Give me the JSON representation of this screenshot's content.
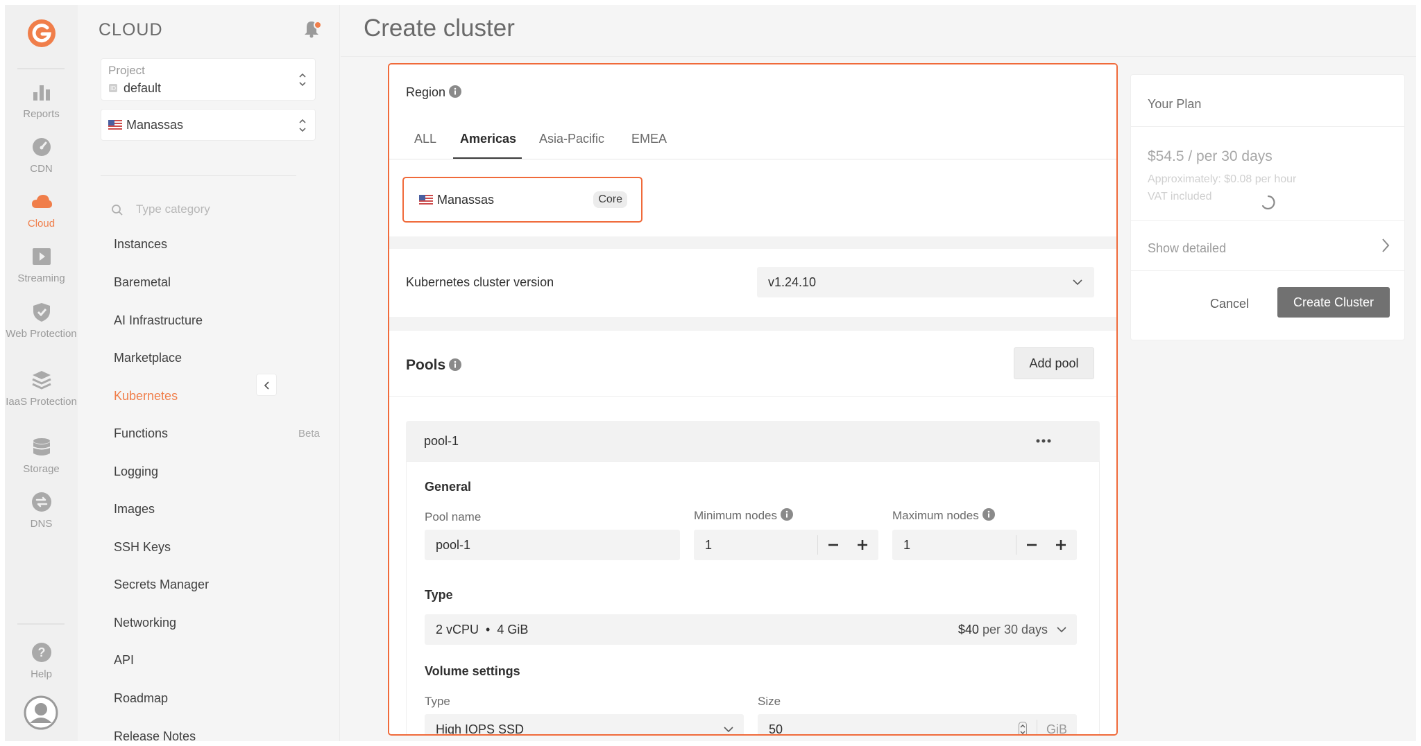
{
  "colors": {
    "accent": "#f07e4a",
    "focus_border": "#f06a3a",
    "primary_button": "#717171"
  },
  "rail": {
    "items": [
      {
        "label": "Reports",
        "icon": "reports-icon"
      },
      {
        "label": "CDN",
        "icon": "cdn-icon"
      },
      {
        "label": "Cloud",
        "icon": "cloud-icon",
        "active": true
      },
      {
        "label": "Streaming",
        "icon": "streaming-icon"
      },
      {
        "label": "Web Protection",
        "icon": "shield-icon"
      },
      {
        "label": "IaaS Protection",
        "icon": "layers-icon"
      },
      {
        "label": "Storage",
        "icon": "storage-icon"
      },
      {
        "label": "DNS",
        "icon": "dns-icon"
      }
    ],
    "help_label": "Help"
  },
  "sidebar": {
    "title": "CLOUD",
    "project_label": "Project",
    "project_value": "default",
    "location_value": "Manassas",
    "search_placeholder": "Type category",
    "items": [
      {
        "label": "Instances"
      },
      {
        "label": "Baremetal"
      },
      {
        "label": "AI Infrastructure"
      },
      {
        "label": "Marketplace"
      },
      {
        "label": "Kubernetes",
        "active": true
      },
      {
        "label": "Functions",
        "badge": "Beta"
      },
      {
        "label": "Logging"
      },
      {
        "label": "Images"
      },
      {
        "label": "SSH Keys"
      },
      {
        "label": "Secrets Manager"
      },
      {
        "label": "Networking"
      },
      {
        "label": "API"
      },
      {
        "label": "Roadmap"
      },
      {
        "label": "Release Notes"
      }
    ]
  },
  "page": {
    "title": "Create cluster"
  },
  "region": {
    "label": "Region",
    "tabs": [
      "ALL",
      "Americas",
      "Asia-Pacific",
      "EMEA"
    ],
    "active_tab": "Americas",
    "selected_name": "Manassas",
    "selected_badge": "Core"
  },
  "k8s": {
    "label": "Kubernetes cluster version",
    "value": "v1.24.10"
  },
  "pools": {
    "label": "Pools",
    "add_label": "Add pool",
    "pool": {
      "name": "pool-1",
      "general_label": "General",
      "pool_name_label": "Pool name",
      "pool_name_value": "pool-1",
      "min_label": "Minimum nodes",
      "min_value": "1",
      "max_label": "Maximum nodes",
      "max_value": "1",
      "type_label": "Type",
      "type_cpu": "2 vCPU",
      "type_sep": "•",
      "type_mem": "4 GiB",
      "type_price": "$40",
      "type_price_suffix": "per 30 days",
      "volume_label": "Volume settings",
      "vol_type_label": "Type",
      "vol_type_value": "High IOPS SSD",
      "vol_size_label": "Size",
      "vol_size_value": "50",
      "vol_size_unit": "GiB"
    }
  },
  "plan": {
    "title": "Your Plan",
    "price": "$54.5 / per 30 days",
    "approx": "Approximately: $0.08 per hour",
    "vat": "VAT included",
    "show_detailed": "Show detailed",
    "cancel": "Cancel",
    "create": "Create Cluster"
  }
}
